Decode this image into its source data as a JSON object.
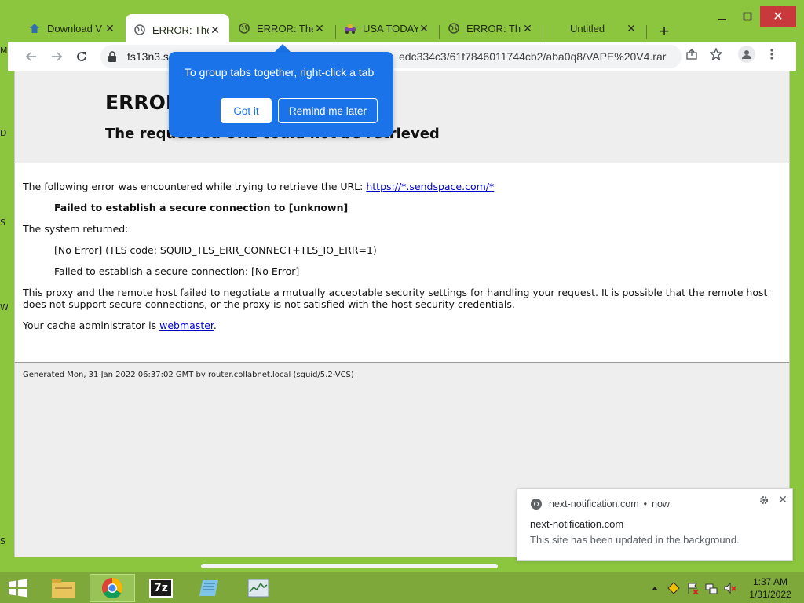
{
  "desktop": {
    "edge_letters": [
      "M",
      "D",
      "S",
      "W",
      "S"
    ]
  },
  "tabs": [
    {
      "title": "Download V",
      "icon": "home-icon"
    },
    {
      "title": "ERROR: The",
      "icon": "globe-icon"
    },
    {
      "title": "ERROR: The",
      "icon": "globe-icon"
    },
    {
      "title": "USA TODAY",
      "icon": "usatoday-icon"
    },
    {
      "title": "ERROR: The",
      "icon": "globe-icon"
    },
    {
      "title": "Untitled",
      "icon": ""
    }
  ],
  "new_tab_label": "+",
  "window_controls": {
    "minimize": "▁",
    "maximize": "▢",
    "close": "✕"
  },
  "omnibox": {
    "url_host": "fs13n3.se",
    "url_tail": "edc334c3/61f7846011744cb2/aba0q8/VAPE%20V4.rar"
  },
  "error_page": {
    "title": "ERROR",
    "subtitle": "The requested URL could not be retrieved",
    "line1_prefix": "The following error was encountered while trying to retrieve the URL:",
    "line1_link": "https://*.sendspace.com/*",
    "failed_bold": "Failed to establish a secure connection to [unknown]",
    "system_returned": "The system returned:",
    "no_error_tls": "[No Error] (TLS code: SQUID_TLS_ERR_CONNECT+TLS_IO_ERR=1)",
    "failed_secure": "Failed to establish a secure connection: [No Error]",
    "proxy_paragraph": "This proxy and the remote host failed to negotiate a mutually acceptable security settings for handling your request. It is possible that the remote host does not support secure connections, or the proxy is not satisfied with the host security credentials.",
    "cache_admin_prefix": "Your cache administrator is",
    "cache_admin_link": "webmaster",
    "cache_admin_suffix": ".",
    "generated": "Generated Mon, 31 Jan 2022 06:37:02 GMT by router.collabnet.local (squid/5.2-VCS)"
  },
  "bubble": {
    "text": "To group tabs together, right-click a tab",
    "got_it": "Got it",
    "remind_later": "Remind me later",
    "bg": "#1a73e8"
  },
  "notification": {
    "source": "next-notification.com",
    "time": "now",
    "title": "next-notification.com",
    "body": "This site has been updated in the background."
  },
  "taskbar": {
    "time": "1:37 AM",
    "date": "1/31/2022",
    "apps": [
      "file-explorer-icon",
      "chrome-icon",
      "7zip-icon",
      "notepad-icon",
      "task-manager-icon"
    ],
    "seven_zip_label": "7z"
  },
  "colors": {
    "desktop_bg": "#8cc63f",
    "link": "#0000cc",
    "close_red": "#c7393a"
  }
}
